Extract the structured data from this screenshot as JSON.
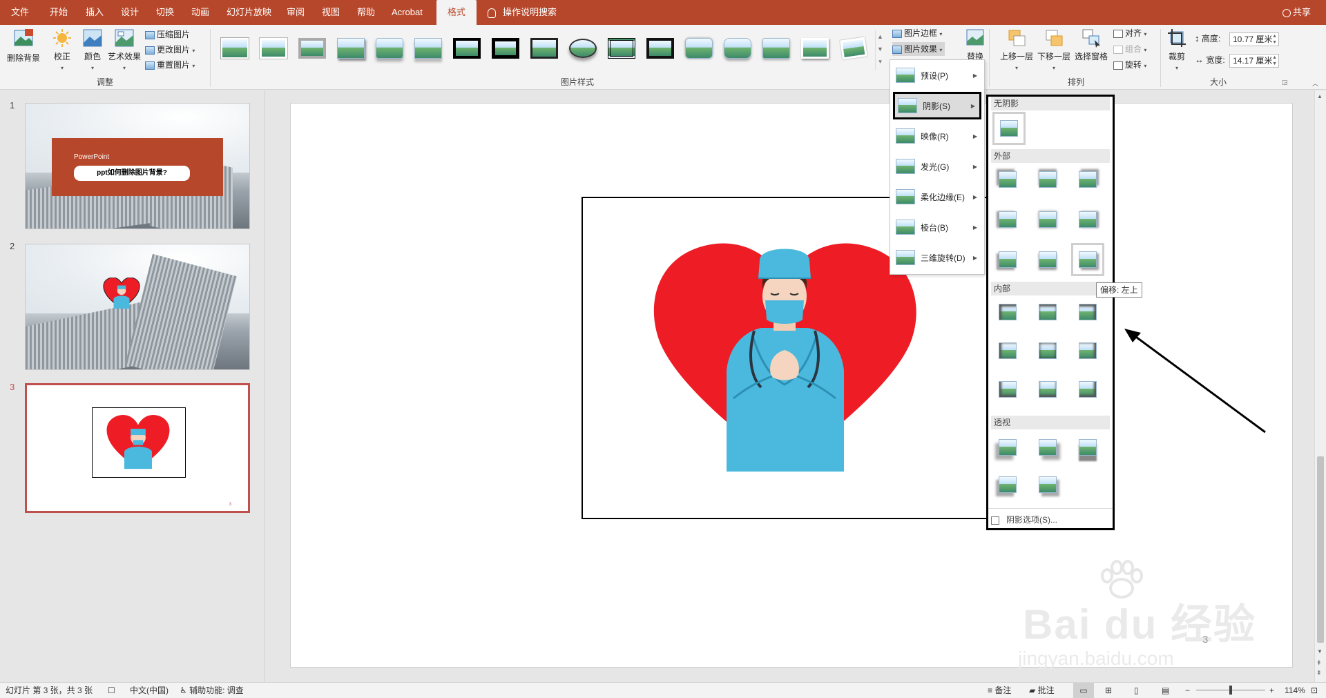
{
  "menubar": {
    "tabs": [
      "文件",
      "开始",
      "插入",
      "设计",
      "切换",
      "动画",
      "幻灯片放映",
      "审阅",
      "视图",
      "帮助",
      "Acrobat",
      "格式"
    ],
    "active_tab": "格式",
    "search": "操作说明搜索",
    "share": "共享"
  },
  "ribbon": {
    "adjust": {
      "remove_bg": "删除背景",
      "correct": "校正",
      "color": "颜色",
      "art_effects": "艺术效果",
      "compress": "压缩图片",
      "change": "更改图片",
      "reset": "重置图片",
      "group_label": "调整"
    },
    "styles": {
      "group_label": "图片样式"
    },
    "border": "图片边框",
    "effects": "图片效果",
    "replace": "替换",
    "arrange": {
      "align": "对齐",
      "group": "组合",
      "rotate": "旋转",
      "bring_forward": "上移一层",
      "send_backward": "下移一层",
      "selection_pane": "选择窗格",
      "group_label": "排列"
    },
    "size": {
      "crop": "裁剪",
      "height_label": "高度:",
      "height_value": "10.77 厘米",
      "width_label": "宽度:",
      "width_value": "14.17 厘米",
      "group_label": "大小"
    }
  },
  "effects_menu": [
    "预设(P)",
    "阴影(S)",
    "映像(R)",
    "发光(G)",
    "柔化边缘(E)",
    "棱台(B)",
    "三维旋转(D)"
  ],
  "shadow_menu": {
    "no_shadow": "无阴影",
    "outer": "外部",
    "inner": "内部",
    "perspective": "透视",
    "options": "阴影选项(S)..."
  },
  "tooltip": "偏移: 左上",
  "slides": {
    "numbers": [
      "1",
      "2",
      "3"
    ],
    "slide1_title": "PowerPoint",
    "slide1_subtitle": "ppt如何删除图片背景?"
  },
  "slide_page_number": "3",
  "statusbar": {
    "slide_info": "幻灯片 第 3 张，共 3 张",
    "language": "中文(中国)",
    "accessibility": "辅助功能: 调查",
    "notes": "备注",
    "comments": "批注",
    "zoom": "114%"
  },
  "watermark": {
    "brand": "Bai du 经验",
    "url": "jingyan.baidu.com"
  },
  "colors": {
    "accent": "#b7472a",
    "heart": "#ee1c25",
    "scrubs": "#4ab9dd"
  }
}
